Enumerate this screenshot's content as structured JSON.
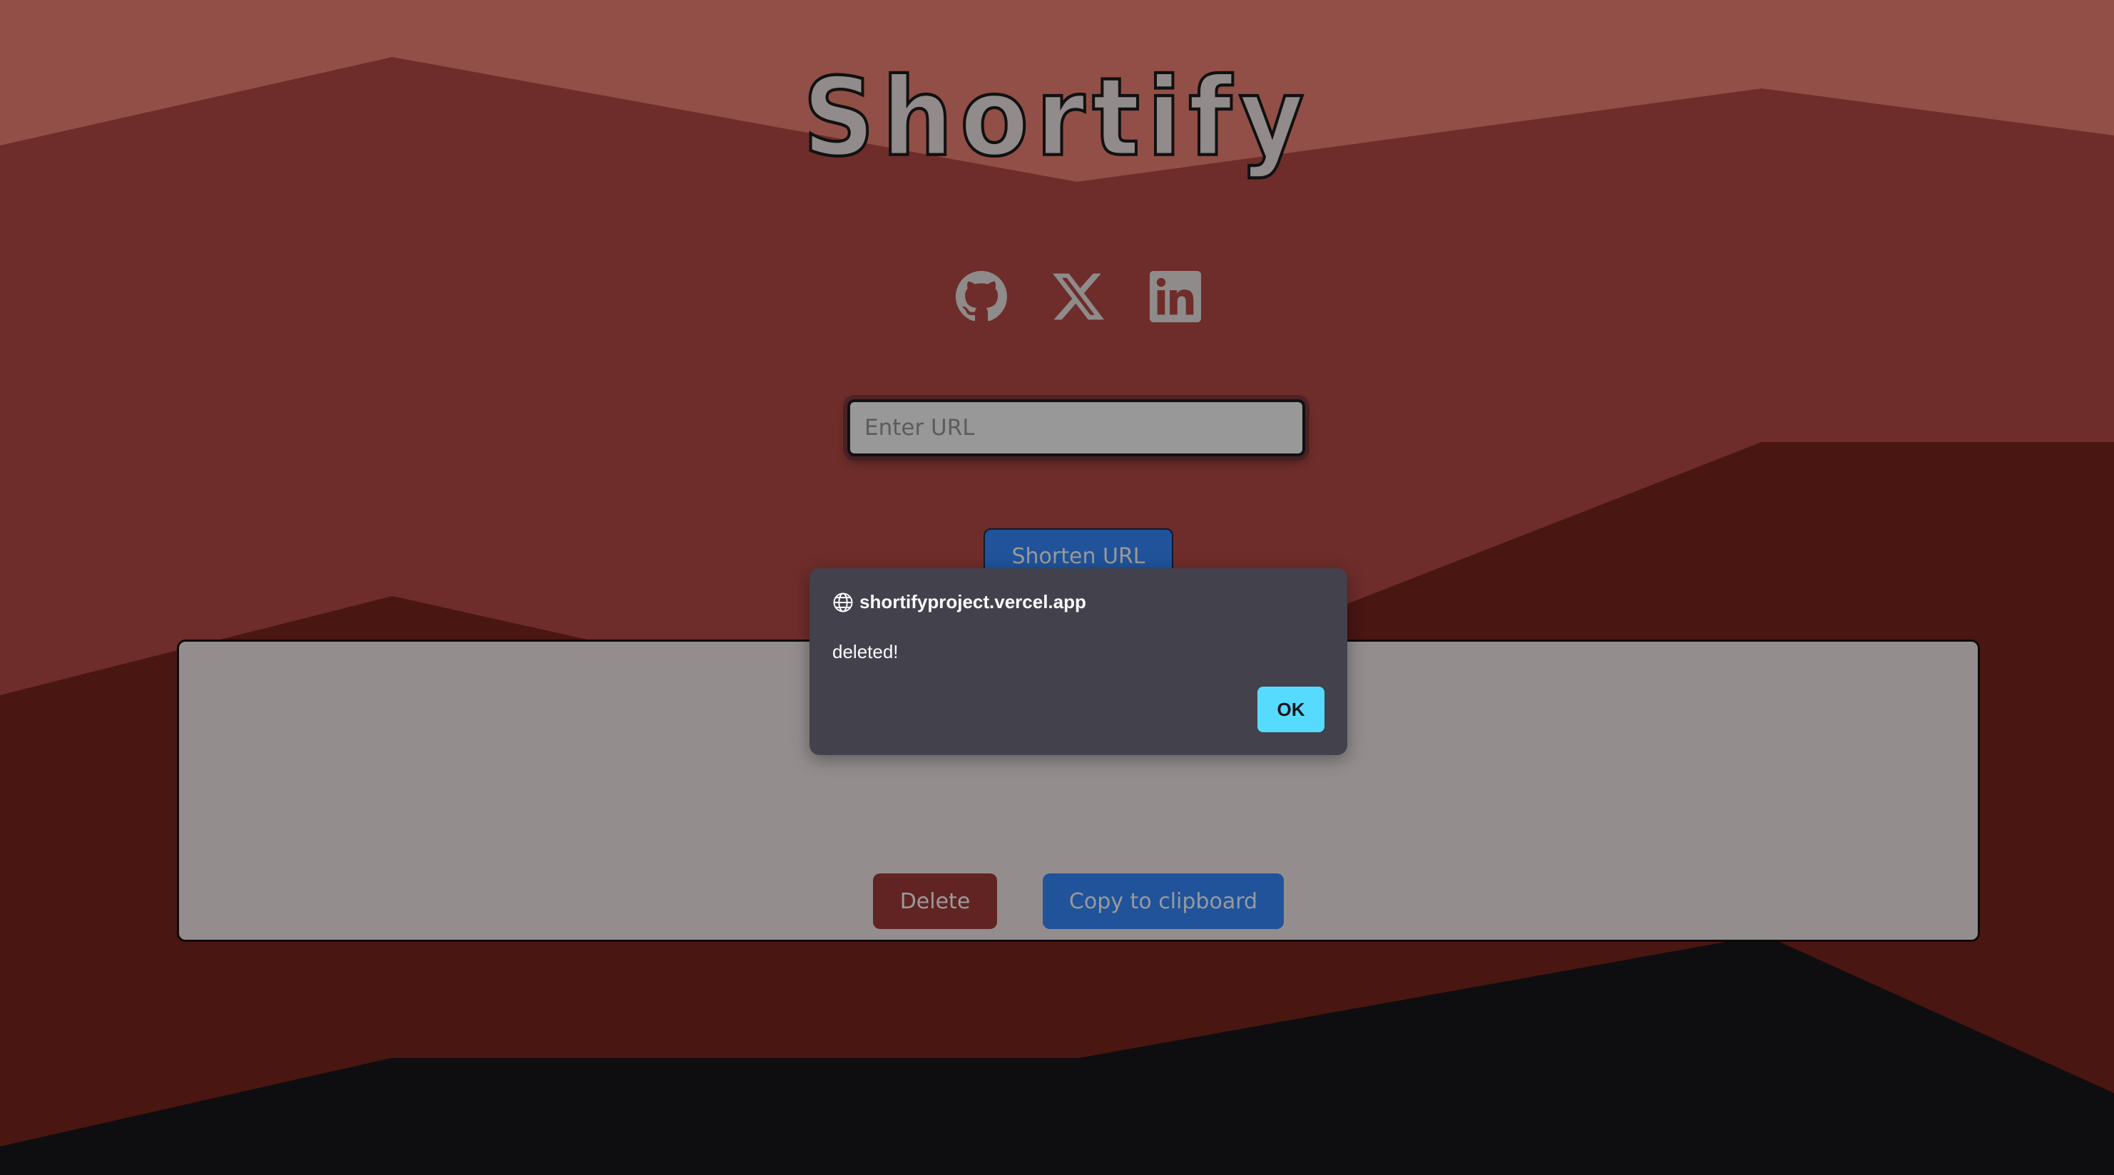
{
  "page": {
    "title": "Shortify"
  },
  "colors": {
    "sky": "#924f47",
    "layer_mid": "#6e2d2a",
    "layer_dark": "#4a1611",
    "layer_black": "#0e0e10",
    "panel": "#938d8d",
    "primary_button": "#20539a",
    "delete_button": "#612422",
    "dialog_bg": "#42414c",
    "dialog_ok": "#56dbfe"
  },
  "socials": [
    {
      "name": "GitHub",
      "icon": "github-icon"
    },
    {
      "name": "X",
      "icon": "x-icon"
    },
    {
      "name": "LinkedIn",
      "icon": "linkedin-icon"
    }
  ],
  "form": {
    "url_value": "",
    "url_placeholder": "Enter URL",
    "shorten_label": "Shorten URL"
  },
  "result": {
    "short_url": "",
    "delete_label": "Delete",
    "copy_label": "Copy to clipboard"
  },
  "dialog": {
    "origin_icon": "globe-icon",
    "origin": "shortifyproject.vercel.app",
    "message": "deleted!",
    "ok_label": "OK"
  }
}
